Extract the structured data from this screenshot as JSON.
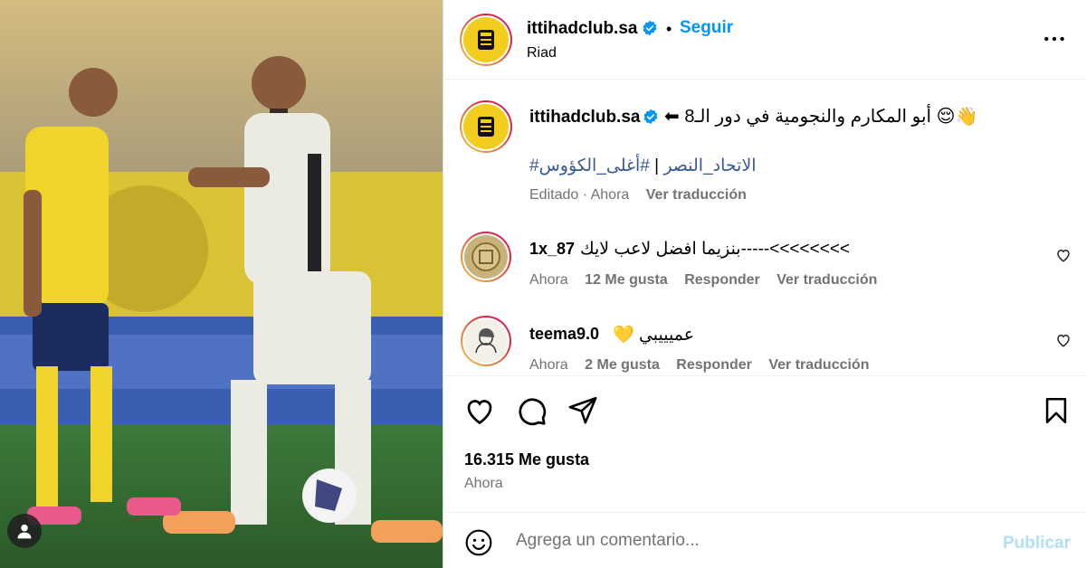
{
  "post": {
    "account": "ittihadclub.sa",
    "follow_label": "Seguir",
    "separator": "•",
    "location": "Riad",
    "more_icon": "more-horizontal-icon"
  },
  "caption": {
    "username": "ittihadclub.sa",
    "text": "⬅ أبو المكارم والنجومية في دور الـ8 😌👋",
    "hashtag_1": "#أغلى_الكؤوس",
    "separator": "|",
    "hashtag_2": "#الاتحاد_النصر",
    "edited": "Editado · Ahora",
    "translate": "Ver traducción"
  },
  "comments": [
    {
      "username": "1x_87",
      "text": "بنزيما افضل لاعب لايك-----<<<<<<<<",
      "time": "Ahora",
      "likes": "12 Me gusta",
      "reply": "Responder",
      "translate": "Ver traducción"
    },
    {
      "username": "teema9.0",
      "text": "💛 عميييبي",
      "time": "Ahora",
      "likes": "2 Me gusta",
      "reply": "Responder",
      "translate": "Ver traducción"
    }
  ],
  "actions": {
    "likes": "16.315 Me gusta",
    "time": "Ahora"
  },
  "add_comment": {
    "placeholder": "Agrega un comentario...",
    "publish": "Publicar"
  },
  "colors": {
    "accent": "#0095f6",
    "publish_disabled": "#b2dffc",
    "muted": "#737373",
    "ittihad_yellow": "#f2cd1d"
  }
}
